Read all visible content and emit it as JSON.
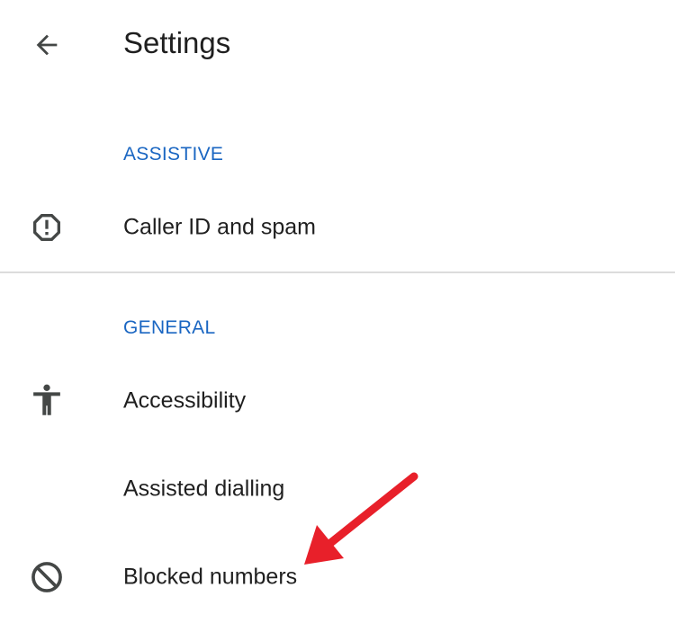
{
  "header": {
    "title": "Settings",
    "back_icon": "arrow-back-icon"
  },
  "sections": [
    {
      "header": "ASSISTIVE",
      "items": [
        {
          "label": "Caller ID and spam",
          "icon": "report-octagon-icon"
        }
      ]
    },
    {
      "header": "GENERAL",
      "items": [
        {
          "label": "Accessibility",
          "icon": "accessibility-icon"
        },
        {
          "label": "Assisted dialling",
          "icon": ""
        },
        {
          "label": "Blocked numbers",
          "icon": "block-icon"
        }
      ]
    }
  ],
  "colors": {
    "section_header": "#1a66c2",
    "text": "#1f1f1f",
    "icon": "#444746",
    "annotation_arrow": "#e8202a"
  }
}
